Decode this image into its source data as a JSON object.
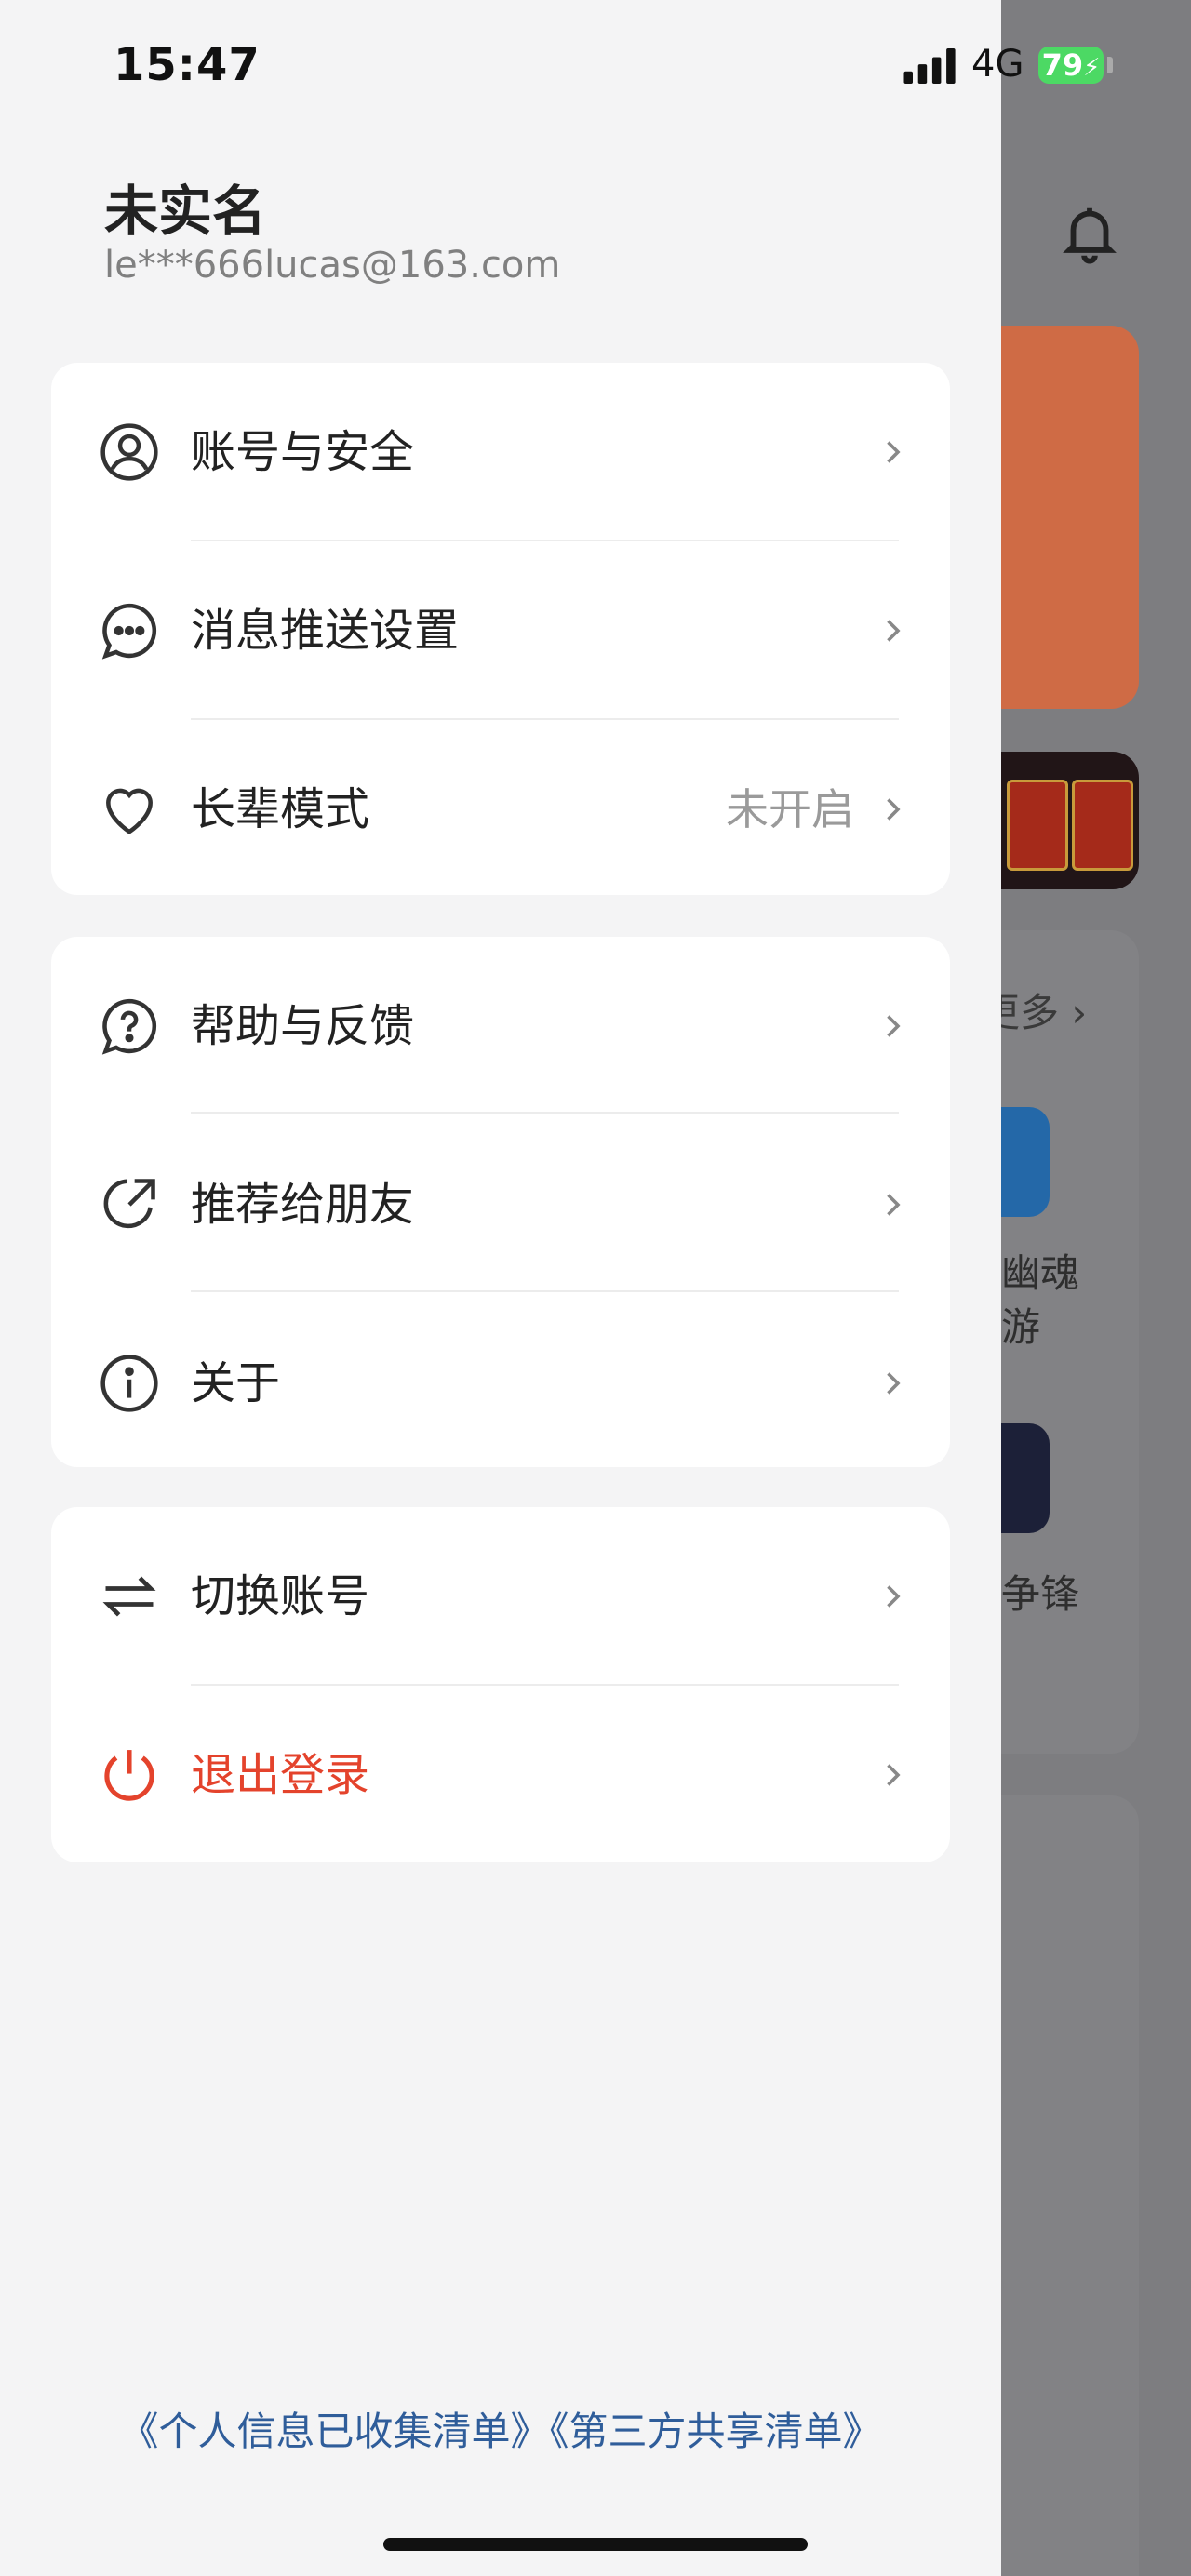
{
  "status_bar": {
    "time": "15:47",
    "network": "4G",
    "battery": "79"
  },
  "profile": {
    "name": "未实名",
    "email": "le***666lucas@163.com"
  },
  "menu_groups": [
    {
      "items": [
        {
          "icon": "user-circle-icon",
          "label": "账号与安全",
          "value": ""
        },
        {
          "icon": "chat-bubble-icon",
          "label": "消息推送设置",
          "value": ""
        },
        {
          "icon": "heart-icon",
          "label": "长辈模式",
          "value": "未开启"
        }
      ]
    },
    {
      "items": [
        {
          "icon": "help-icon",
          "label": "帮助与反馈",
          "value": ""
        },
        {
          "icon": "share-icon",
          "label": "推荐给朋友",
          "value": ""
        },
        {
          "icon": "info-icon",
          "label": "关于",
          "value": ""
        }
      ]
    },
    {
      "items": [
        {
          "icon": "swap-icon",
          "label": "切换账号",
          "value": ""
        },
        {
          "icon": "power-icon",
          "label": "退出登录",
          "value": "",
          "danger": true
        }
      ]
    }
  ],
  "footer": {
    "link1": "《个人信息已收集清单》",
    "link2": "《第三方共享清单》"
  },
  "background_app": {
    "more_label": "更多",
    "app1_name": "幽魂",
    "app1_sub": "游",
    "app2_name": "争锋"
  },
  "colors": {
    "danger": "#e4432c",
    "link": "#2f5d9a",
    "battery": "#4cd964"
  }
}
